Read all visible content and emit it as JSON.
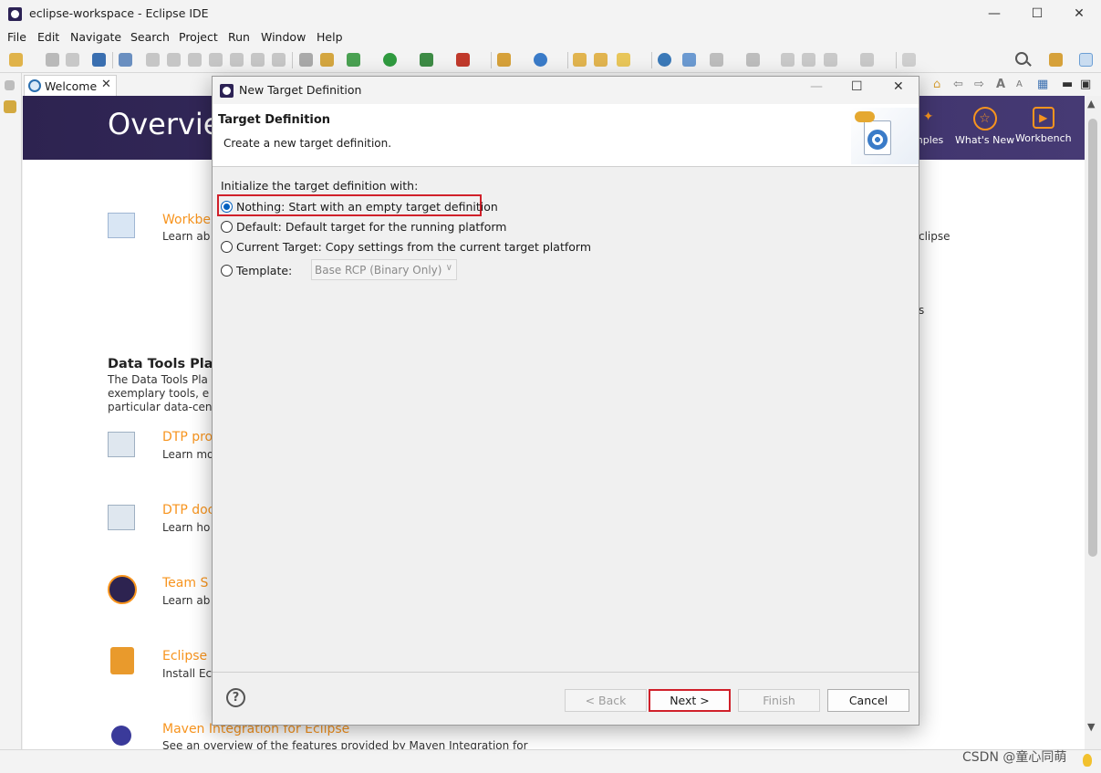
{
  "window": {
    "title": "eclipse-workspace - Eclipse IDE",
    "minimize": "—",
    "maximize": "☐",
    "close": "✕"
  },
  "menu": {
    "items": [
      "File",
      "Edit",
      "Navigate",
      "Search",
      "Project",
      "Run",
      "Window",
      "Help"
    ]
  },
  "editor": {
    "tab_label": "Welcome",
    "tab_close": "✕"
  },
  "welcome": {
    "banner_title": "Overvie",
    "banner_items": {
      "samples": "mples",
      "whats_new": "What's New",
      "workbench": "Workbench"
    },
    "workbench_link": "Workbe",
    "workbench_sub": "Learn ab",
    "right_cut_1": "clipse",
    "right_cut_2": "s",
    "dtp_title": "Data Tools Pla",
    "dtp_text_1": "The Data Tools Pla",
    "dtp_text_2": "exemplary tools, e",
    "dtp_text_3": "particular data-cen",
    "items": [
      {
        "link": "DTP pro",
        "sub": "Learn mo"
      },
      {
        "link": "DTP doc",
        "sub": "Learn ho"
      },
      {
        "link": "Team S",
        "sub": "Learn ab"
      },
      {
        "link": "Eclipse",
        "sub": "Install Ec"
      },
      {
        "link": "Maven Integration for Eclipse",
        "sub": "See an overview of the features provided by Maven Integration for"
      }
    ]
  },
  "dialog": {
    "title": "New Target Definition",
    "minimize": "—",
    "maximize": "☐",
    "close": "✕",
    "header_title": "Target Definition",
    "header_desc": "Create a new target definition.",
    "init_label": "Initialize the target definition with:",
    "options": [
      {
        "label": "Nothing: Start with an empty target definition",
        "selected": true
      },
      {
        "label": "Default: Default target for the running platform",
        "selected": false
      },
      {
        "label": "Current Target: Copy settings from the current target platform",
        "selected": false
      },
      {
        "label": "Template:",
        "selected": false
      }
    ],
    "template_combo": {
      "value": "Base RCP (Binary Only)",
      "disabled": true
    },
    "help": "?",
    "buttons": {
      "back": "< Back",
      "next": "Next >",
      "finish": "Finish",
      "cancel": "Cancel"
    }
  },
  "watermark": "CSDN @童心同萌",
  "colors": {
    "accent_orange": "#f7941e",
    "banner_purple": "#2d2350",
    "highlight_red": "#d0202a",
    "radio_blue": "#0060c0"
  },
  "icons": [
    "eclipse-icon",
    "search-icon",
    "help-icon",
    "home-icon",
    "back-arrow-icon",
    "forward-arrow-icon",
    "chevron-down-icon"
  ]
}
